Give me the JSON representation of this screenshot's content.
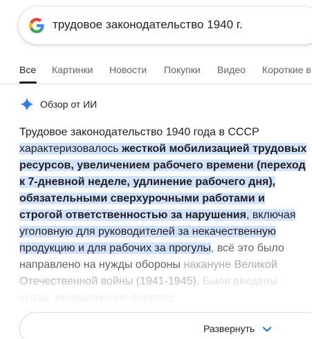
{
  "search": {
    "query": "трудовое законодательство 1940 г.",
    "logo_icon": "google-g-icon"
  },
  "tabs": [
    {
      "label": "Все",
      "active": true
    },
    {
      "label": "Картинки",
      "active": false
    },
    {
      "label": "Новости",
      "active": false
    },
    {
      "label": "Покупки",
      "active": false
    },
    {
      "label": "Видео",
      "active": false
    },
    {
      "label": "Короткие в",
      "active": false
    }
  ],
  "ai_overview": {
    "icon": "gemini-spark-icon",
    "title": "Обзор от ИИ",
    "text_lead": "Трудовое законодательство 1940 года в СССР",
    "text_hl_plain": " характеризовалось ",
    "text_hl_bold": "жесткой мобилизацией трудовых ресурсов, увеличением рабочего времени (переход к 7-дневной неделе, удлинение рабочего дня), обязательными сверхурочными работами и строгой ответственностью за нарушения",
    "text_hl_tail": ", включая уголовную для руководителей за некачественную продукцию и для рабочих за прогулы",
    "text_after": ", всё это было направлено на нужды обороны",
    "text_fade_1": "накануне Великой Отечественной войны (1941-1945).",
    "text_fade_2": "Были введены указы, обязывающие перевод"
  },
  "expand": {
    "label": "Развернуть",
    "icon": "chevron-down-icon"
  },
  "colors": {
    "highlight": "#d3e3fd",
    "accent_blue": "#4285f4",
    "text": "#1f1f1f",
    "muted": "#5f6368"
  }
}
